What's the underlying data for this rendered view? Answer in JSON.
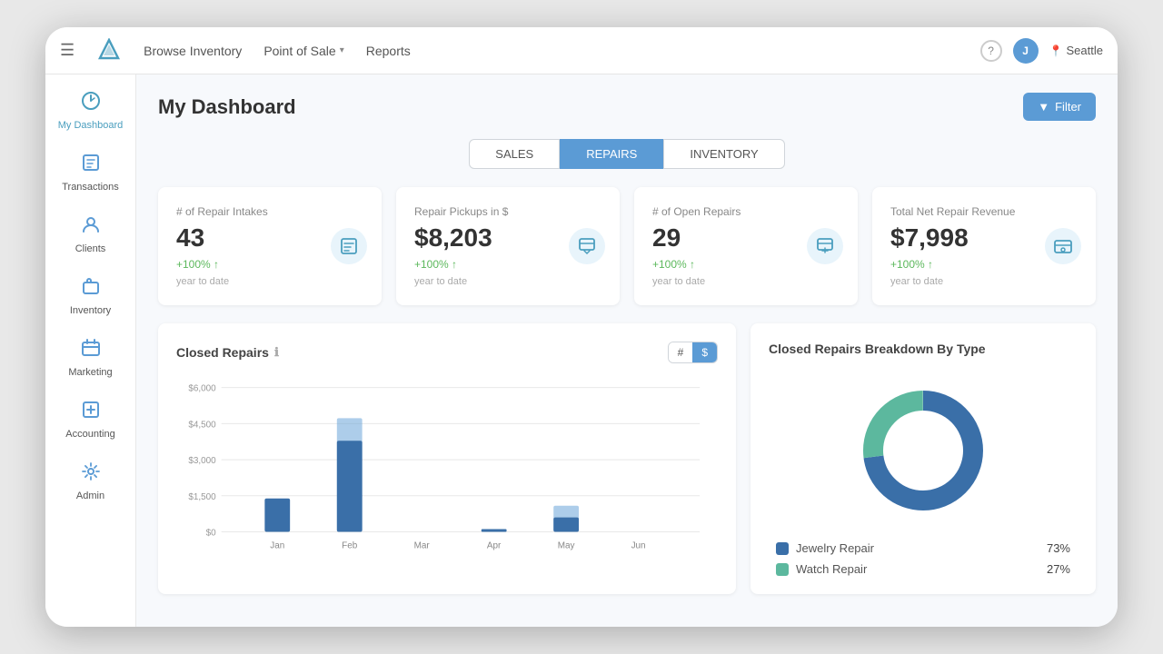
{
  "nav": {
    "menu_icon": "☰",
    "browse_inventory": "Browse Inventory",
    "point_of_sale": "Point of Sale",
    "reports": "Reports",
    "help_label": "?",
    "avatar_label": "J",
    "location": "Seattle",
    "location_icon": "📍"
  },
  "sidebar": {
    "items": [
      {
        "id": "my-dashboard",
        "label": "My Dashboard",
        "icon": "📊",
        "active": true
      },
      {
        "id": "transactions",
        "label": "Transactions",
        "icon": "🏷️",
        "active": false
      },
      {
        "id": "clients",
        "label": "Clients",
        "icon": "👤",
        "active": false
      },
      {
        "id": "inventory",
        "label": "Inventory",
        "icon": "📦",
        "active": false
      },
      {
        "id": "marketing",
        "label": "Marketing",
        "icon": "🛒",
        "active": false
      },
      {
        "id": "accounting",
        "label": "Accounting",
        "icon": "📋",
        "active": false
      },
      {
        "id": "admin",
        "label": "Admin",
        "icon": "🔧",
        "active": false
      }
    ]
  },
  "page_title": "My Dashboard",
  "filter_button": "Filter",
  "tabs": [
    {
      "id": "sales",
      "label": "SALES",
      "active": false
    },
    {
      "id": "repairs",
      "label": "REPAIRS",
      "active": true
    },
    {
      "id": "inventory",
      "label": "INVENTORY",
      "active": false
    }
  ],
  "stats": [
    {
      "id": "repair-intakes",
      "label": "# of Repair Intakes",
      "value": "43",
      "change": "+100%",
      "period": "year to date",
      "icon": "📋"
    },
    {
      "id": "repair-pickups",
      "label": "Repair Pickups in $",
      "value": "$8,203",
      "change": "+100%",
      "period": "year to date",
      "icon": "📤"
    },
    {
      "id": "open-repairs",
      "label": "# of Open Repairs",
      "value": "29",
      "change": "+100%",
      "period": "year to date",
      "icon": "📤"
    },
    {
      "id": "net-revenue",
      "label": "Total Net Repair Revenue",
      "value": "$7,998",
      "change": "+100%",
      "period": "year to date",
      "icon": "💳"
    }
  ],
  "closed_repairs_chart": {
    "title": "Closed Repairs",
    "toggle_hash": "#",
    "toggle_dollar": "$",
    "months": [
      "Jan",
      "Feb",
      "Mar",
      "Apr",
      "May",
      "Jun"
    ],
    "y_labels": [
      "$6,000",
      "$4,500",
      "$3,000",
      "$1,500",
      "$0"
    ],
    "bars": [
      {
        "month": "Jan",
        "actual": 1400,
        "total": 1400,
        "max": 6000
      },
      {
        "month": "Feb",
        "actual": 3800,
        "total": 4700,
        "max": 6000
      },
      {
        "month": "Mar",
        "actual": 0,
        "total": 0,
        "max": 6000
      },
      {
        "month": "Apr",
        "actual": 120,
        "total": 120,
        "max": 6000
      },
      {
        "month": "May",
        "actual": 600,
        "total": 1100,
        "max": 6000
      },
      {
        "month": "Jun",
        "actual": 0,
        "total": 0,
        "max": 6000
      }
    ]
  },
  "breakdown_chart": {
    "title": "Closed Repairs Breakdown By Type",
    "segments": [
      {
        "label": "Jewelry Repair",
        "pct": 73,
        "color": "#3a6fa8"
      },
      {
        "label": "Watch Repair",
        "pct": 27,
        "color": "#5cb89e"
      }
    ]
  }
}
